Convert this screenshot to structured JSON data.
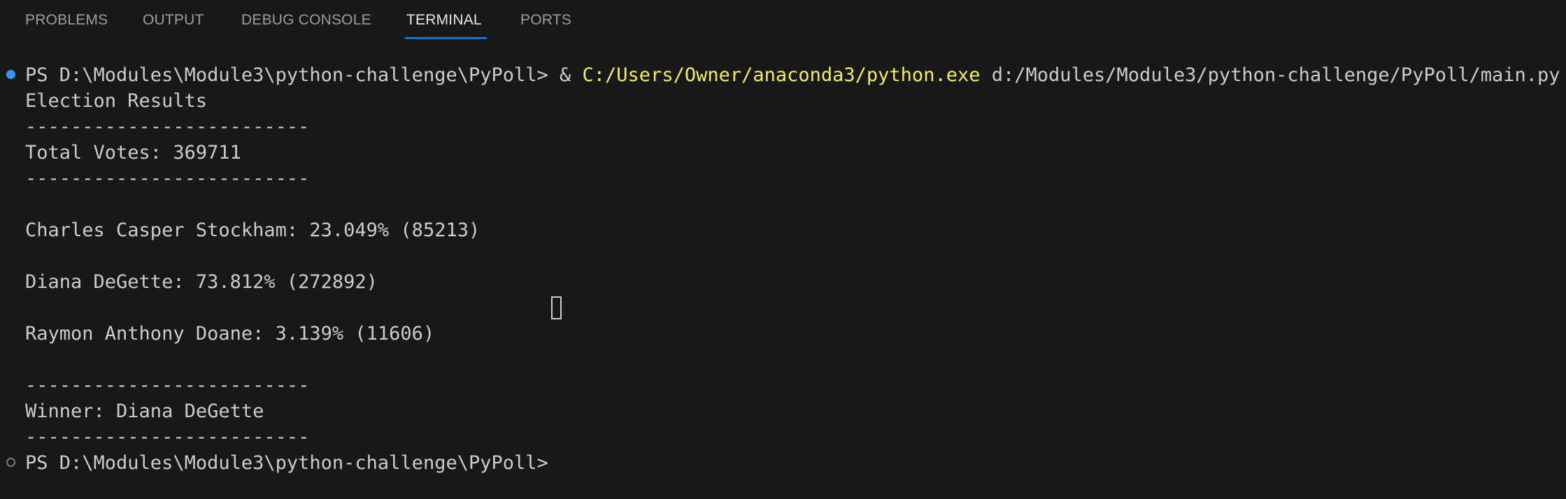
{
  "panel": {
    "tabs": [
      {
        "label": "PROBLEMS",
        "active": false
      },
      {
        "label": "OUTPUT",
        "active": false
      },
      {
        "label": "DEBUG CONSOLE",
        "active": false
      },
      {
        "label": "TERMINAL",
        "active": true
      },
      {
        "label": "PORTS",
        "active": false
      }
    ]
  },
  "terminal": {
    "command": {
      "prompt": "PS D:\\Modules\\Module3\\python-challenge\\PyPoll> ",
      "operator": "& ",
      "executable": "C:/Users/Owner/anaconda3/python.exe",
      "script": " d:/Modules/Module3/python-challenge/PyPoll/main.py",
      "status_icon": "command-success-dot-icon"
    },
    "output": [
      "Election Results",
      "-------------------------",
      "Total Votes: 369711",
      "-------------------------",
      "",
      "Charles Casper Stockham: 23.049% (85213)",
      "",
      "Diana DeGette: 73.812% (272892)",
      "",
      "Raymon Anthony Doane: 3.139% (11606)",
      "",
      "-------------------------",
      "Winner: Diana DeGette",
      "-------------------------"
    ],
    "final_prompt": "PS D:\\Modules\\Module3\\python-challenge\\PyPoll>",
    "final_status_icon": "command-pending-circle-icon",
    "cursor_icon": "terminal-cursor-icon"
  },
  "colors": {
    "background": "#181818",
    "text": "#cccccc",
    "executable": "#f0f059",
    "active_tab_underline": "#0078d4",
    "success_dot": "#3794ff"
  }
}
